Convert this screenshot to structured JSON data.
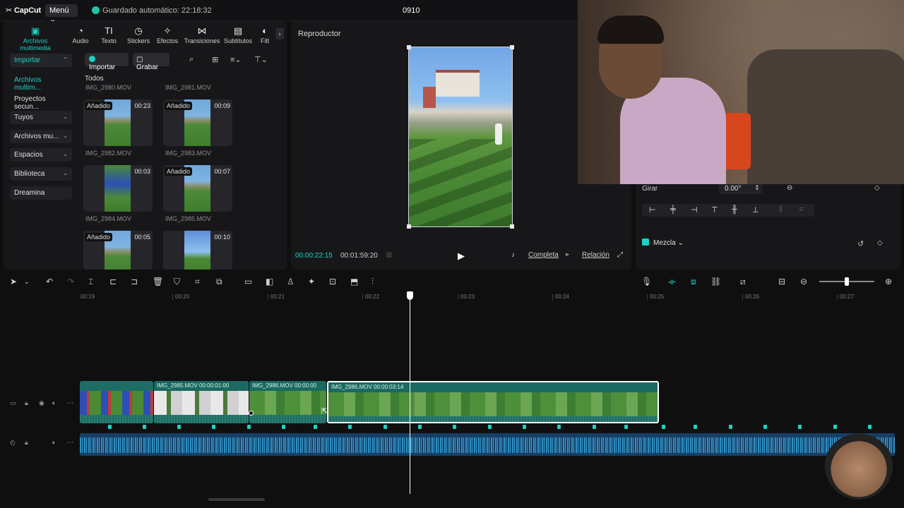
{
  "topbar": {
    "app_name": "CapCut",
    "menu_label": "Menú",
    "autosave": "Guardado automático: 22:18:32",
    "project_title": "0910"
  },
  "media_tabs": [
    {
      "label": "Archivos multimedia",
      "icon": "media-icon"
    },
    {
      "label": "Audio",
      "icon": "audio-icon"
    },
    {
      "label": "Texto",
      "icon": "text-icon"
    },
    {
      "label": "Stickers",
      "icon": "sticker-icon"
    },
    {
      "label": "Efectos",
      "icon": "effects-icon"
    },
    {
      "label": "Transiciones",
      "icon": "transitions-icon"
    },
    {
      "label": "Subtítulos",
      "icon": "subtitles-icon"
    },
    {
      "label": "Filt",
      "icon": "filters-icon"
    }
  ],
  "sidebar": {
    "items": [
      {
        "label": "Importar"
      },
      {
        "label": "Archivos multim..."
      },
      {
        "label": "Proyectos secun..."
      },
      {
        "label": "Tuyos"
      },
      {
        "label": "Archivos mu..."
      },
      {
        "label": "Espacios"
      },
      {
        "label": "Biblioteca"
      },
      {
        "label": "Dreamina"
      }
    ]
  },
  "media": {
    "import_label": "Importar",
    "record_label": "Grabar",
    "filter_all": "Todos",
    "files": [
      {
        "name": "IMG_2980.MOV"
      },
      {
        "name": "IMG_2981.MOV"
      },
      {
        "name": "IMG_2982.MOV",
        "badge": "Añadido",
        "duration": "00:23"
      },
      {
        "name": "IMG_2983.MOV",
        "badge": "Añadido",
        "duration": "00:09"
      },
      {
        "name": "IMG_2984.MOV",
        "badge": "",
        "duration": "00:03"
      },
      {
        "name": "IMG_2985.MOV",
        "badge": "Añadido",
        "duration": "00:07"
      },
      {
        "name": "",
        "badge": "Añadido",
        "duration": "00:05"
      },
      {
        "name": "",
        "badge": "",
        "duration": "00:10"
      }
    ]
  },
  "player": {
    "title": "Reproductor",
    "current_time": "00:00:22:15",
    "total_time": "00:01:59:20",
    "full_label": "Completa",
    "ratio_label": "Relación"
  },
  "properties": {
    "rotate_label": "Girar",
    "rotate_value": "0.00°",
    "blend_label": "Mezcla"
  },
  "ruler": {
    "labels": [
      "00:19",
      "00:20",
      "00:21",
      "00:22",
      "00:23",
      "00:24",
      "00:25",
      "00:26",
      "00:27"
    ]
  },
  "clips": [
    {
      "label": ""
    },
    {
      "label": "IMG_2985.MOV  00:00:01:00"
    },
    {
      "label": "IMG_2986.MOV  00:00:00"
    },
    {
      "label": "IMG_2986.MOV  00:00:03:14"
    }
  ],
  "colors": {
    "accent": "#1fd1c1",
    "clip": "#1d6d65",
    "audio": "#173f66"
  }
}
